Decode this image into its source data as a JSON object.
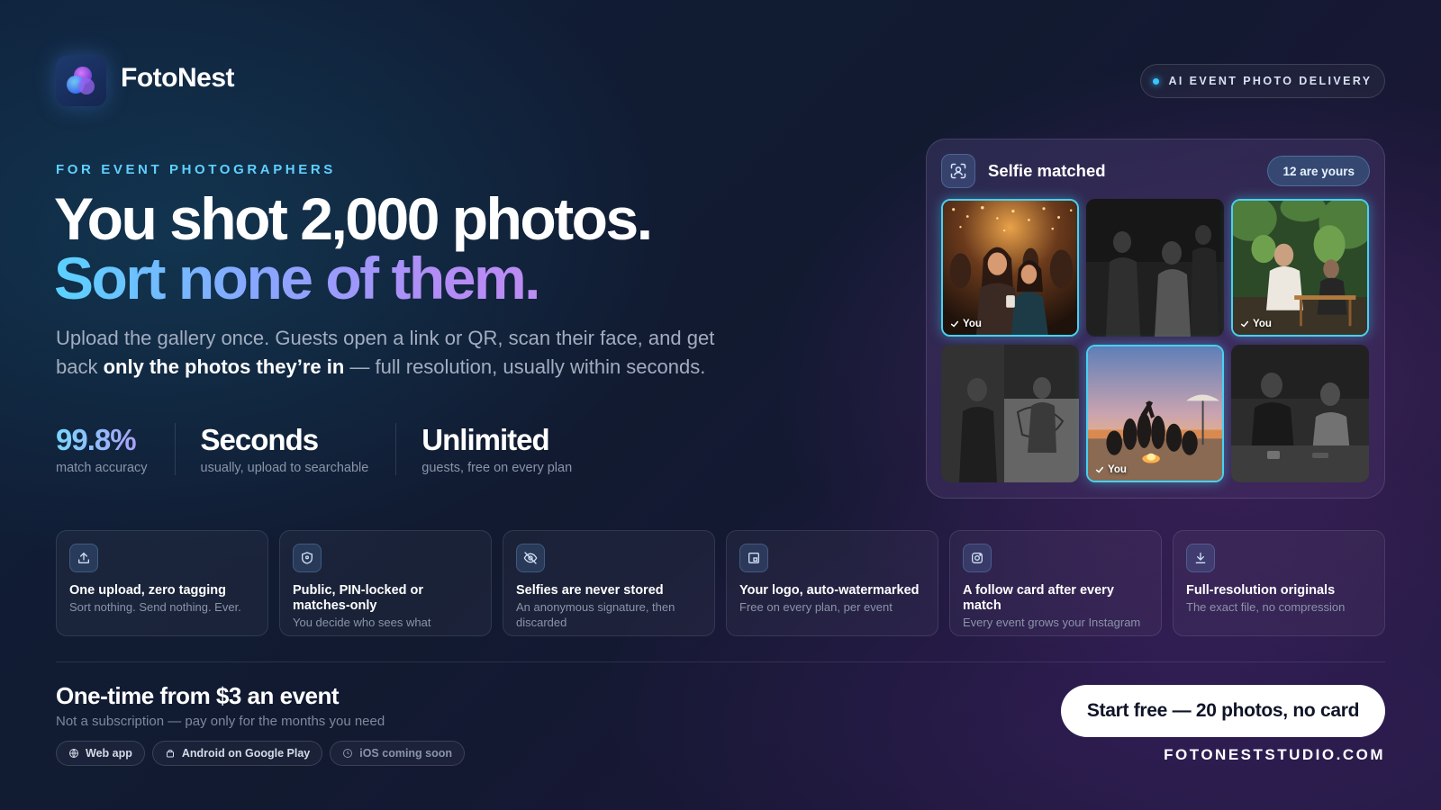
{
  "header": {
    "brand_name": "FotoNest",
    "tag_pill": "AI EVENT PHOTO DELIVERY"
  },
  "hero": {
    "eyebrow": "FOR EVENT PHOTOGRAPHERS",
    "headline_line1": "You shot 2,000 photos.",
    "headline_line2": "Sort none of them.",
    "subtitle_part1": "Upload the gallery once. Guests open a link or QR, scan their face, and get back ",
    "subtitle_bold": "only the photos they’re in",
    "subtitle_part2": " — full resolution, usually within seconds."
  },
  "stats": [
    {
      "value": "99.8%",
      "label": "match accuracy"
    },
    {
      "value": "Seconds",
      "label": "usually, upload to searchable"
    },
    {
      "value": "Unlimited",
      "label": "guests, free on every plan"
    }
  ],
  "match_panel": {
    "icon": "face-scan-icon",
    "title": "Selfie matched",
    "badge": "12 are yours",
    "photos": [
      {
        "scene": "party-two-women",
        "matched": true,
        "tag": "You"
      },
      {
        "scene": "dark-crowd",
        "matched": false,
        "tag": ""
      },
      {
        "scene": "garden-cafe",
        "matched": true,
        "tag": "You"
      },
      {
        "scene": "bar-counter",
        "matched": false,
        "tag": ""
      },
      {
        "scene": "beach-sunset",
        "matched": true,
        "tag": "You"
      },
      {
        "scene": "cafe-table",
        "matched": false,
        "tag": ""
      }
    ]
  },
  "features": [
    {
      "icon": "upload-icon",
      "title": "One upload, zero tagging",
      "subtitle": "Sort nothing. Send nothing. Ever."
    },
    {
      "icon": "shield-icon",
      "title": "Public, PIN-locked or matches-only",
      "subtitle": "You decide who sees what"
    },
    {
      "icon": "eye-off-icon",
      "title": "Selfies are never stored",
      "subtitle": "An anonymous signature, then discarded"
    },
    {
      "icon": "watermark-icon",
      "title": "Your logo, auto-watermarked",
      "subtitle": "Free on every plan, per event"
    },
    {
      "icon": "instagram-icon",
      "title": "A follow card after every match",
      "subtitle": "Every event grows your Instagram"
    },
    {
      "icon": "download-icon",
      "title": "Full-resolution originals",
      "subtitle": "The exact file, no compression"
    }
  ],
  "footer": {
    "price": "One-time from $3 an event",
    "price_sub": "Not a subscription — pay only for the months you need",
    "platforms": [
      {
        "icon": "globe-icon",
        "label": "Web app"
      },
      {
        "icon": "android-icon",
        "label": "Android on Google Play"
      },
      {
        "icon": "clock-icon",
        "label": "iOS coming soon"
      }
    ],
    "cta": "Start free — 20 photos, no card",
    "website": "FOTONESTSTUDIO.COM"
  },
  "colors": {
    "accent_cyan": "#48d1f0",
    "accent_purple": "#b38cf5",
    "background": "#111a30"
  }
}
